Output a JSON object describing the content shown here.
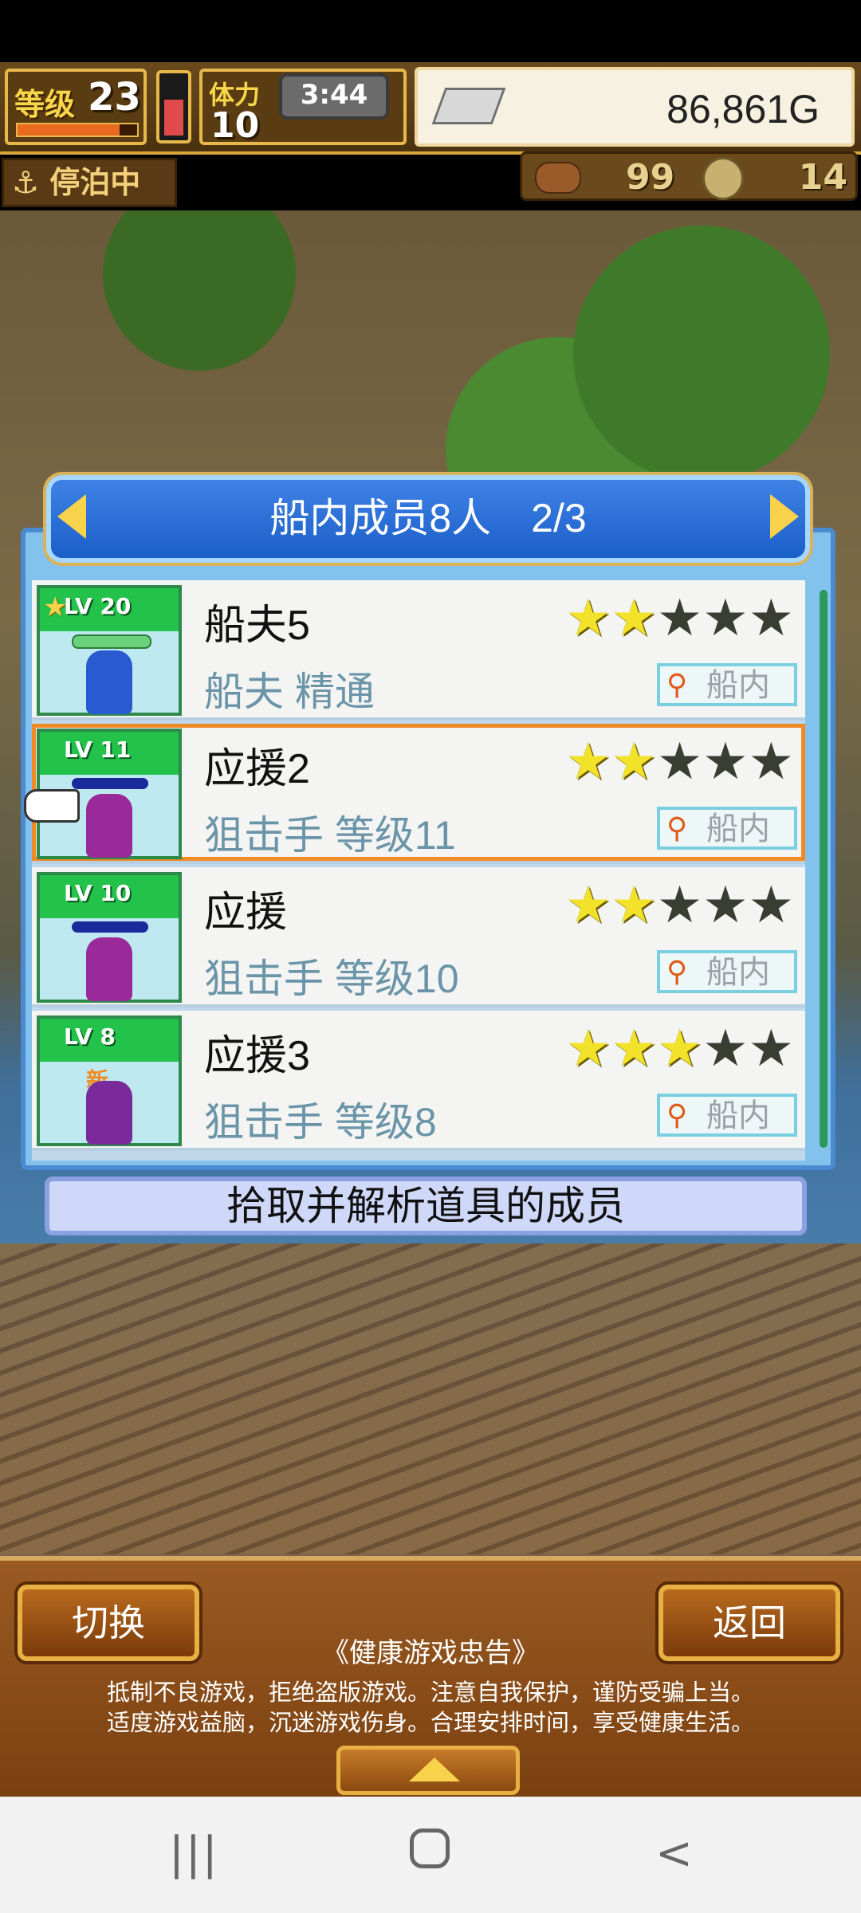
{
  "hud": {
    "level_label": "等级",
    "level_value": "23",
    "level_progress": 0.85,
    "hp_fill": 0.62,
    "stamina_label": "体力",
    "stamina_value": "10",
    "time": "3:44",
    "gold": "86,861G",
    "moored_label": "停泊中",
    "food_value": "99",
    "coin_value": "14"
  },
  "dialog": {
    "title": "船内成员8人　2/3",
    "members": [
      {
        "lv": "LV 20",
        "name": "船夫5",
        "sub": "船夫 精通",
        "stars": 2,
        "tag": "船内",
        "featured": true,
        "selected": false,
        "new": false,
        "fig_color": "#2a5ad0"
      },
      {
        "lv": "LV 11",
        "name": "应援2",
        "sub": "狙击手 等级11",
        "stars": 2,
        "tag": "船内",
        "featured": false,
        "selected": true,
        "new": false,
        "fig_color": "#9a2a9a"
      },
      {
        "lv": "LV 10",
        "name": "应援",
        "sub": "狙击手 等级10",
        "stars": 2,
        "tag": "船内",
        "featured": false,
        "selected": false,
        "new": false,
        "fig_color": "#9a2a9a"
      },
      {
        "lv": "LV 8",
        "name": "应援3",
        "sub": "狙击手 等级8",
        "stars": 3,
        "tag": "船内",
        "featured": false,
        "selected": false,
        "new": true,
        "new_label": "新",
        "fig_color": "#7a2a9a"
      }
    ],
    "description": "拾取并解析道具的成员"
  },
  "bottom": {
    "switch_label": "切换",
    "back_label": "返回",
    "notice_title": "《健康游戏忠告》",
    "notice_line1": "抵制不良游戏，拒绝盗版游戏。注意自我保护，谨防受骗上当。",
    "notice_line2": "适度游戏益脑，沉迷游戏伤身。合理安排时间，享受健康生活。"
  },
  "nav": {
    "recent_glyph": "|||",
    "back_glyph": "<"
  }
}
